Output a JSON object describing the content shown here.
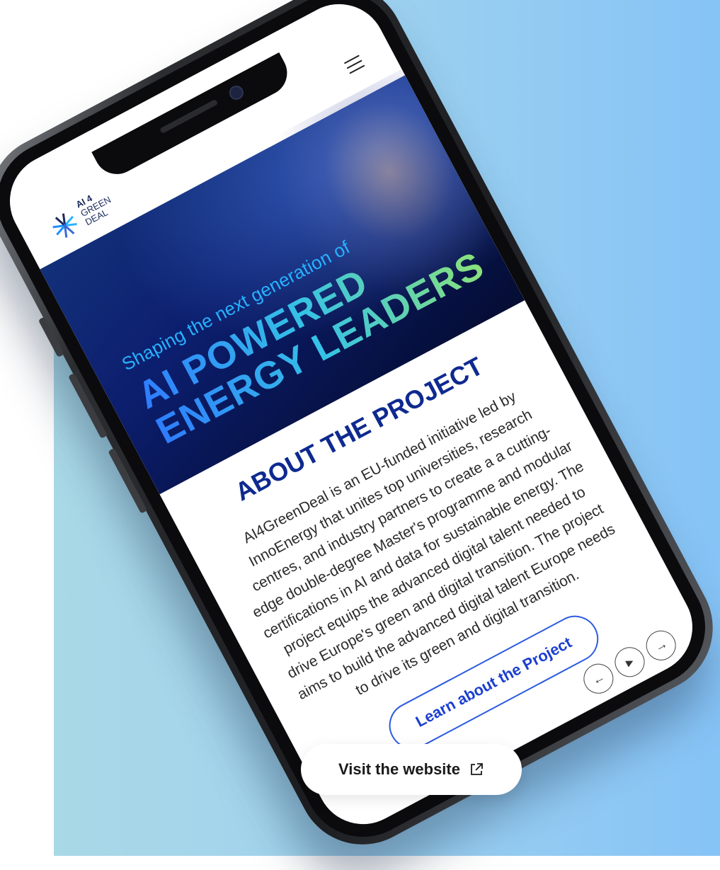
{
  "colors": {
    "background_gradient": [
      "#a9d8e6",
      "#86c3f6"
    ],
    "hero_dark": "#0c1e6e",
    "title_blue": "#0e2a8f",
    "accent_blue": "#2b5be0",
    "gradient_green": "#8be27a"
  },
  "logo": {
    "line1": "AI 4",
    "line2": "GREEN",
    "line3": "DEAL"
  },
  "nav": {
    "menu_icon": "hamburger-menu-icon"
  },
  "hero": {
    "subtitle": "Shaping the next generation of",
    "title_line1": "AI POWERED",
    "title_line2": "ENERGY LEADERS"
  },
  "about": {
    "title": "ABOUT THE PROJECT",
    "body": "AI4GreenDeal is an EU-funded initiative led by InnoEnergy that unites top universities, research centres, and industry partners to create a a cutting-edge double-degree Master's programme and modular certifications in AI and data for sustainable energy. The project equips the advanced digital talent needed to drive Europe's green and digital transition. The project aims to build the advanced digital talent Europe needs to drive its green and digital transition.",
    "cta_label": "Learn about the Project"
  },
  "carousel": {
    "prev_symbol": "←",
    "play_symbol": "▶",
    "next_symbol": "→"
  },
  "visit_button": {
    "label": "Visit the website",
    "icon": "external-link-icon"
  }
}
